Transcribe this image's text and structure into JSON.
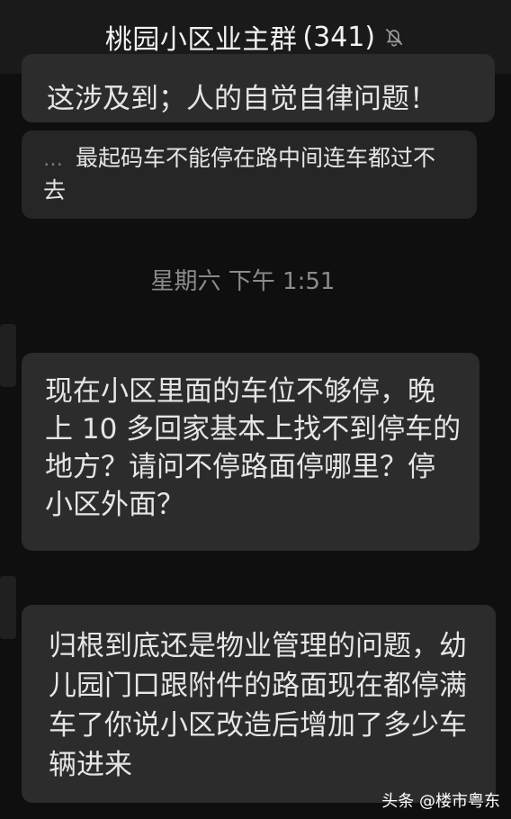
{
  "header": {
    "title": "桃园小区业主群",
    "count": "(341)",
    "mute_icon": "bell-off-icon"
  },
  "messages": [
    {
      "text": "这涉及到；人的自觉自律问题！"
    },
    {
      "prefix": "…",
      "text": "最起码车不能停在路中间连车都过不去"
    }
  ],
  "timestamp": "星期六 下午 1:51",
  "messages2": [
    {
      "text": "现在小区里面的车位不够停，晚上 10 多回家基本上找不到停车的地方？请问不停路面停哪里？停小区外面？"
    },
    {
      "text": "归根到底还是物业管理的问题，幼儿园门口跟附件的路面现在都停满车了你说小区改造后增加了多少车辆进来"
    }
  ],
  "watermark": "头条 @楼市粤东"
}
